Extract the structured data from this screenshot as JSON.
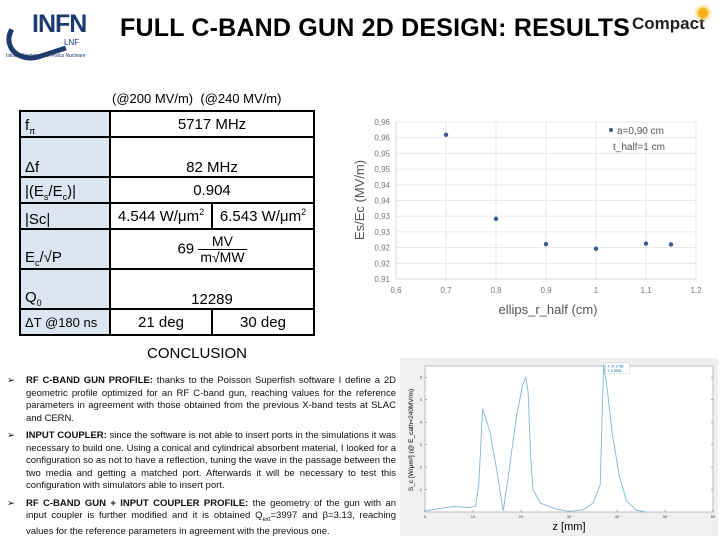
{
  "header": {
    "logo_text": "INFN",
    "logo_sub": "LNF",
    "logo_caption": "Istituto Nazionale di Fisica Nucleare",
    "title": "FULL C-BAND GUN 2D DESIGN: RESULTS",
    "brand": "Compact"
  },
  "table": {
    "col_headers": "(@200 MV/m)  (@240 MV/m)",
    "rows": {
      "f_pi": {
        "label": "f",
        "sub": "π",
        "value": "5717 MHz"
      },
      "delta_f": {
        "label": "Δf",
        "value": "82 MHz"
      },
      "es_ec": {
        "label": "|(E",
        "sub1": "s",
        "mid": "/E",
        "sub2": "c",
        "end": ")|",
        "value": "0.904"
      },
      "sc": {
        "label": "|Sc|",
        "value_200": "4.544 W/μm",
        "value_240": "6.543 W/μm",
        "sup": "2"
      },
      "ec_sqrtp": {
        "label": "E",
        "sub": "c",
        "end": "/√P",
        "value": "69",
        "unit_num": "MV",
        "unit_den": "m√MW"
      },
      "q0": {
        "label": "Q",
        "sub": "0",
        "value": "12289"
      },
      "delta_t": {
        "label": "ΔT @180 ns",
        "value_200": "21 deg",
        "value_240": "30 deg"
      }
    }
  },
  "chart_data": [
    {
      "type": "scatter",
      "title": "",
      "xlabel": "ellips_r_half (cm)",
      "ylabel": "Es/Ec (MV/m)",
      "xlim": [
        0.6,
        1.2
      ],
      "ylim": [
        0.91,
        0.965
      ],
      "x_ticks": [
        "0,6",
        "0,7",
        "0,8",
        "0,9",
        "1",
        "1,1",
        "1,2"
      ],
      "y_ticks": [
        "0,91",
        "0,92",
        "0,92",
        "0,93",
        "0,93",
        "0,94",
        "0,94",
        "0,95",
        "0,95",
        "0,96",
        "0,96"
      ],
      "grid": true,
      "legend": {
        "position": "top-right",
        "entries": [
          "a=0,90 cm",
          "t_half=1 cm"
        ]
      },
      "series": [
        {
          "name": "a=0,90 cm",
          "color": "#3c5a8c",
          "x": [
            0.7,
            0.8,
            0.9,
            1.0,
            1.1,
            1.15
          ],
          "y": [
            0.9605,
            0.9311,
            0.9222,
            0.9206,
            0.9224,
            0.9221
          ]
        }
      ]
    },
    {
      "type": "line",
      "title": "",
      "xlabel": "z [mm]",
      "ylabel": "S_c [W/μm²] (@ E_cath=240MV/m)",
      "xlim": [
        0,
        60
      ],
      "ylim": [
        0,
        6.5
      ],
      "x_ticks": [
        "0",
        "10",
        "20",
        "30",
        "40",
        "50",
        "60"
      ],
      "y_ticks": [
        "1",
        "2",
        "3",
        "4",
        "5",
        "6"
      ],
      "grid": false,
      "datatip": {
        "x_label": "X 37.1758",
        "y_label": "Y 6.5556"
      },
      "series": [
        {
          "name": "Sc",
          "color": "#7fb7d6",
          "x": [
            0,
            3,
            6,
            9,
            10.5,
            11.2,
            12,
            13.5,
            15,
            16.3,
            17.5,
            19,
            20.3,
            21,
            21.5,
            22,
            22.5,
            24,
            27,
            30,
            33,
            35,
            36.5,
            37.2,
            38,
            39,
            40.5,
            42,
            44,
            46
          ],
          "y": [
            0.05,
            0.15,
            0.25,
            0.2,
            0.25,
            1.2,
            4.6,
            3.6,
            1.8,
            0.05,
            1.8,
            4.2,
            5.6,
            6.0,
            5.3,
            2.5,
            1.0,
            0.4,
            0.15,
            0.02,
            0.1,
            0.4,
            1.2,
            6.55,
            5.4,
            3.5,
            1.6,
            0.5,
            0.08,
            0.0
          ]
        }
      ]
    }
  ],
  "conclusion": {
    "title": "CONCLUSION",
    "arrow": "➢",
    "points": [
      {
        "heading": "RF C-BAND GUN PROFILE:",
        "text": " thanks to the Poisson Superfish software I define a 2D geometric profile optimized for an RF C-band gun, reaching values for the reference parameters in agreement with those obtained from the previous X-band tests at SLAC and CERN."
      },
      {
        "heading": "INPUT COUPLER:",
        "text": " since the software is not able to insert ports in the simulations it was necessary to build one. Using a conical and cylindrical absorbent material, I looked for a configuration so as not to have a reflection, tuning the wave in the passage between the two media and getting a matched port. Afterwards it will be necessary to test this configuration with simulators able to insert port."
      },
      {
        "heading": "RF C-BAND GUN + INPUT COUPLER PROFILE:",
        "text_a": " the geometry of the gun with an input coupler is further modified and it is obtained Q",
        "sub": "ext",
        "text_b": "=3997 and β=3.13, reaching values for the reference parameters in agreement with the previous one."
      }
    ]
  }
}
